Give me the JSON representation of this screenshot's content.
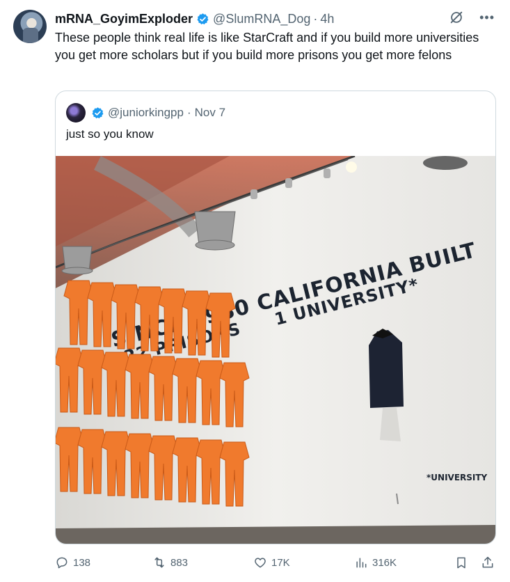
{
  "tweet": {
    "display_name": "mRNA_GoyimExploder",
    "handle": "@SlumRNA_Dog",
    "separator": "·",
    "time": "4h",
    "text": "These people think real life is like StarCraft and if you build more universities you get more scholars but if you build more prisons you get more felons",
    "icons": {
      "avatar": "user-avatar",
      "verified": "verified-badge-icon",
      "grok": "grok-icon",
      "more": "more-options-icon"
    }
  },
  "quote": {
    "handle": "@juniorkingpp",
    "separator": "·",
    "date": "Nov 7",
    "text": "just so you know",
    "image": {
      "headline_line1": "SINCE 1980 CALIFORNIA BUILT",
      "line2_left": "22 PRISONS",
      "line2_right": "1 UNIVERSITY*",
      "footnote": "*UNIVERSITY"
    }
  },
  "actions": {
    "replies": "138",
    "reposts": "883",
    "likes": "17K",
    "views": "316K",
    "icons": [
      "reply-icon",
      "retweet-icon",
      "like-icon",
      "views-icon",
      "bookmark-icon",
      "share-icon"
    ]
  },
  "colors": {
    "verified": "#1d9bf0",
    "text": "#0f1419",
    "muted": "#536471",
    "border": "#cfd9de",
    "jumpsuit": "#f07a2d"
  }
}
